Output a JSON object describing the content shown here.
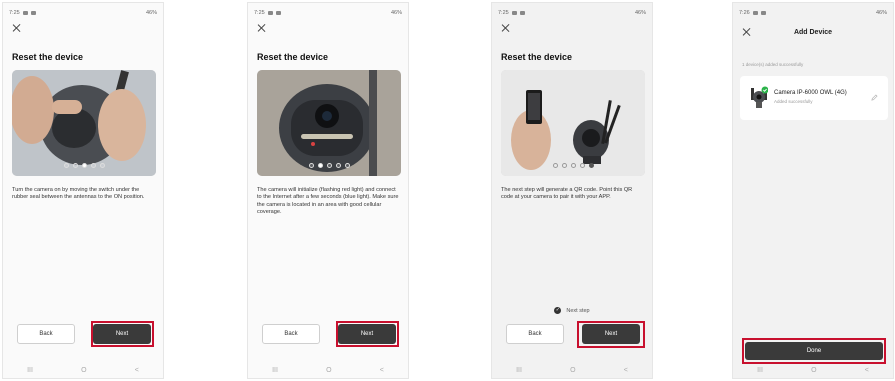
{
  "screens": [
    {
      "status_time": "7:25",
      "status_right": "46%",
      "title": "Reset the device",
      "description": "Turn the camera on by moving the switch under the rubber seal between the antennas to the ON position.",
      "back_label": "Back",
      "next_label": "Next"
    },
    {
      "status_time": "7:25",
      "status_right": "46%",
      "title": "Reset the device",
      "description": "The camera will initialize (flashing red light) and connect to the Internet after a few seconds (blue light). Make sure the camera is located in an area with good cellular coverage.",
      "back_label": "Back",
      "next_label": "Next"
    },
    {
      "status_time": "7:25",
      "status_right": "46%",
      "title": "Reset the device",
      "description": "The next step will generate a QR code. Point this QR code at your camera to pair it with your APP.",
      "next_step_label": "Next step",
      "back_label": "Back",
      "next_label": "Next"
    },
    {
      "status_time": "7:26",
      "status_right": "46%",
      "title": "Add Device",
      "subline": "1 device(s) added successfully",
      "device_name": "Camera IP-6000 OWL (4G)",
      "device_status": "Added successfully",
      "done_label": "Done"
    }
  ],
  "navbar": {
    "recent": "III",
    "home": "O",
    "back": "<"
  },
  "colors": {
    "highlight": "#c8102e",
    "button_dark": "#3a3a3a",
    "success": "#2bb34a"
  },
  "icons": [
    "close-icon",
    "check-circle-icon",
    "edit-icon",
    "battery-icon",
    "signal-icon"
  ]
}
